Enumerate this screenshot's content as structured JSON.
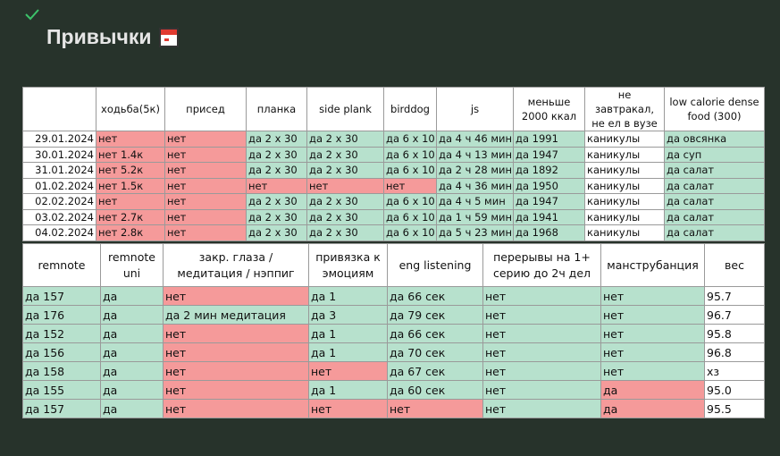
{
  "page": {
    "title": "Привычки"
  },
  "colors": {
    "green": "#b7e1cd",
    "red": "#f59a9a",
    "background": "#27332b"
  },
  "table1": {
    "headers": [
      "",
      "ходьба(5к)",
      "присед",
      "планка",
      "side plank",
      "birddog",
      "js",
      "меньше 2000 ккал",
      "не завтракал, не ел в вузе",
      "low calorie dense food (300)"
    ],
    "rows": [
      {
        "cells": [
          "29.01.2024",
          "нет",
          "нет",
          "да 2 x 30",
          "да 2 x 30",
          "да 6 x 10",
          "да 4 ч 46 мин",
          "да 1991",
          "каникулы",
          "да овсянка"
        ],
        "status": [
          "w",
          "r",
          "r",
          "g",
          "g",
          "g",
          "g",
          "g",
          "w",
          "g"
        ]
      },
      {
        "cells": [
          "30.01.2024",
          "нет 1.4к",
          "нет",
          "да 2 x 30",
          "да 2 x 30",
          "да 6 x 10",
          "да 4 ч 13 мин",
          "да 1947",
          "каникулы",
          "да суп"
        ],
        "status": [
          "w",
          "r",
          "r",
          "g",
          "g",
          "g",
          "g",
          "g",
          "w",
          "g"
        ]
      },
      {
        "cells": [
          "31.01.2024",
          "нет 5.2к",
          "нет",
          "да 2 x 30",
          "да 2 x 30",
          "да 6 x 10",
          "да 2 ч 28 мин",
          "да 1892",
          "каникулы",
          "да салат"
        ],
        "status": [
          "w",
          "r",
          "r",
          "g",
          "g",
          "g",
          "g",
          "g",
          "w",
          "g"
        ]
      },
      {
        "cells": [
          "01.02.2024",
          "нет 1.5к",
          "нет",
          "нет",
          "нет",
          "нет",
          "да 4 ч 36 мин",
          "да 1950",
          "каникулы",
          "да салат"
        ],
        "status": [
          "w",
          "r",
          "r",
          "r",
          "r",
          "r",
          "g",
          "g",
          "w",
          "g"
        ]
      },
      {
        "cells": [
          "02.02.2024",
          "нет",
          "нет",
          "да 2 x 30",
          "да 2 x 30",
          "да 6 x 10",
          "да 4 ч 5 мин",
          "да 1947",
          "каникулы",
          "да салат"
        ],
        "status": [
          "w",
          "r",
          "r",
          "g",
          "g",
          "g",
          "g",
          "g",
          "w",
          "g"
        ]
      },
      {
        "cells": [
          "03.02.2024",
          "нет 2.7к",
          "нет",
          "да 2 x 30",
          "да 2 x 30",
          "да 6 x 10",
          "да 1 ч 59 мин",
          "да 1941",
          "каникулы",
          "да салат"
        ],
        "status": [
          "w",
          "r",
          "r",
          "g",
          "g",
          "g",
          "g",
          "g",
          "w",
          "g"
        ]
      },
      {
        "cells": [
          "04.02.2024",
          "нет 2.8к",
          "нет",
          "да 2 x 30",
          "да 2 x 30",
          "да 6 x 10",
          "да 5 ч 23 мин",
          "да 1968",
          "каникулы",
          "да салат"
        ],
        "status": [
          "w",
          "r",
          "r",
          "g",
          "g",
          "g",
          "g",
          "g",
          "w",
          "g"
        ]
      }
    ]
  },
  "table2": {
    "headers": [
      "remnote",
      "remnote uni",
      "закр. глаза / медитация / нэппиг",
      "привязка к эмоциям",
      "eng listening",
      "перерывы на 1+ серию до 2ч дел",
      "манструбанция",
      "вес"
    ],
    "rows": [
      {
        "cells": [
          "да 157",
          "да",
          "нет",
          "да 1",
          "да 66 сек",
          "нет",
          "нет",
          "95.7"
        ],
        "status": [
          "g",
          "g",
          "r",
          "g",
          "g",
          "g",
          "g",
          "w"
        ]
      },
      {
        "cells": [
          "да 176",
          "да",
          "да 2 мин медитация",
          "да 3",
          "да 79 сек",
          "нет",
          "нет",
          "96.7"
        ],
        "status": [
          "g",
          "g",
          "g",
          "g",
          "g",
          "g",
          "g",
          "w"
        ]
      },
      {
        "cells": [
          "да 152",
          "да",
          "нет",
          "да 1",
          "да 66 сек",
          "нет",
          "нет",
          "95.8"
        ],
        "status": [
          "g",
          "g",
          "r",
          "g",
          "g",
          "g",
          "g",
          "w"
        ]
      },
      {
        "cells": [
          "да 156",
          "да",
          "нет",
          "да 1",
          "да 70 сек",
          "нет",
          "нет",
          "96.8"
        ],
        "status": [
          "g",
          "g",
          "r",
          "g",
          "g",
          "g",
          "g",
          "w"
        ]
      },
      {
        "cells": [
          "да 158",
          "да",
          "нет",
          "нет",
          "да 67 сек",
          "нет",
          "нет",
          "хз"
        ],
        "status": [
          "g",
          "g",
          "r",
          "r",
          "g",
          "g",
          "g",
          "w"
        ]
      },
      {
        "cells": [
          "да 155",
          "да",
          "нет",
          "да 1",
          "да 60 сек",
          "нет",
          "да",
          "95.0"
        ],
        "status": [
          "g",
          "g",
          "r",
          "g",
          "g",
          "g",
          "r",
          "w"
        ]
      },
      {
        "cells": [
          "да 157",
          "да",
          "нет",
          "нет",
          "нет",
          "нет",
          "да",
          "95.5"
        ],
        "status": [
          "g",
          "g",
          "r",
          "r",
          "r",
          "g",
          "r",
          "w"
        ]
      }
    ]
  }
}
